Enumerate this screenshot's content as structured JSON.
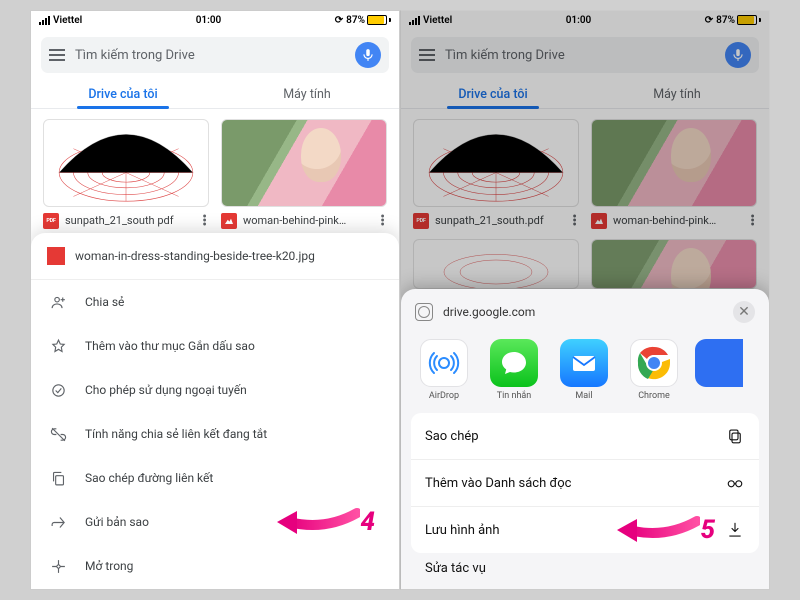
{
  "status": {
    "carrier": "Viettel",
    "time": "01:00",
    "battery": "87%"
  },
  "search": {
    "placeholder": "Tìm kiếm trong Drive"
  },
  "tabs": {
    "mine": "Drive của tôi",
    "computers": "Máy tính"
  },
  "files": {
    "sunpath": "sunpath_21_south.pdf",
    "sunpath_cut": "sunpath_21_south pdf",
    "woman": "woman-behind-pink…"
  },
  "sheet": {
    "filename": "woman-in-dress-standing-beside-tree-k20.jpg",
    "share": "Chia sẻ",
    "star": "Thêm vào thư mục Gắn dấu sao",
    "offline": "Cho phép sử dụng ngoại tuyến",
    "linkoff": "Tính năng chia sẻ liên kết đang tắt",
    "copylink": "Sao chép đường liên kết",
    "sendcopy": "Gửi bản sao",
    "openin": "Mở trong"
  },
  "share": {
    "host": "drive.google.com",
    "airdrop": "AirDrop",
    "messages": "Tin nhắn",
    "mail": "Mail",
    "chrome": "Chrome",
    "copy": "Sao chép",
    "reading": "Thêm vào Danh sách đọc",
    "saveimg": "Lưu hình ảnh",
    "more": "Sửa tác vụ"
  },
  "call": {
    "n4": "4",
    "n5": "5"
  }
}
